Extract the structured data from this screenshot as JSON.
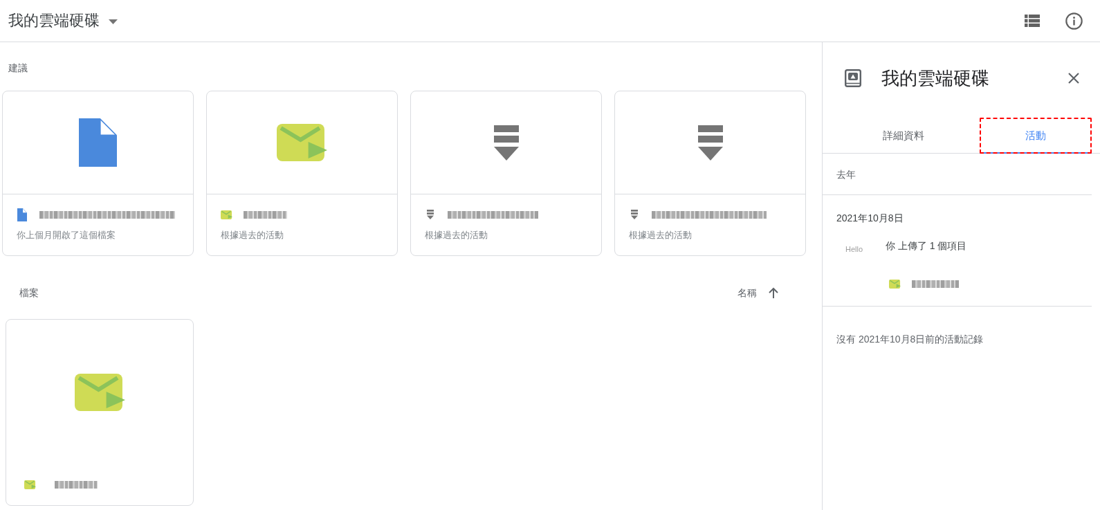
{
  "header": {
    "title": "我的雲端硬碟"
  },
  "suggested": {
    "heading": "建議",
    "cards": [
      {
        "kind": "document",
        "subtitle": "你上個月開啟了這個檔案"
      },
      {
        "kind": "exe",
        "subtitle": "根據過去的活動"
      },
      {
        "kind": "zip",
        "subtitle": "根據過去的活動"
      },
      {
        "kind": "zip",
        "subtitle": "根據過去的活動"
      }
    ]
  },
  "files": {
    "heading": "檔案",
    "sort": {
      "label": "名稱",
      "ascending": true
    },
    "cards": [
      {
        "kind": "exe"
      }
    ]
  },
  "details_panel": {
    "title": "我的雲端硬碟",
    "tabs": [
      {
        "label": "詳細資料",
        "selected": false,
        "highlighted": false
      },
      {
        "label": "活動",
        "selected": true,
        "highlighted": true
      }
    ],
    "period": "去年",
    "groups": [
      {
        "date": "2021年10月8日",
        "activities": [
          {
            "avatar_text": "Hello",
            "text": "你 上傳了 1 個項目",
            "files": [
              {
                "kind": "exe"
              }
            ]
          }
        ]
      }
    ],
    "end_note": "沒有 2021年10月8日前的活動記錄"
  }
}
